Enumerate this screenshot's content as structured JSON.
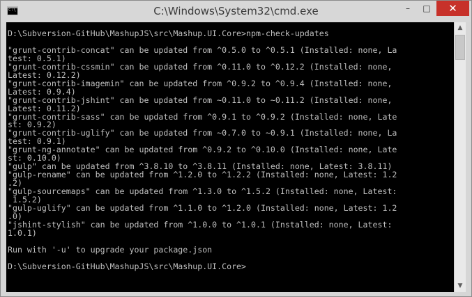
{
  "window": {
    "title": "C:\\Windows\\System32\\cmd.exe",
    "controls": {
      "minimize": "–",
      "maximize": "□",
      "close": "✕"
    },
    "icon": "cmd-icon",
    "icon_text": "C:\\"
  },
  "console": {
    "lines": [
      "D:\\Subversion-GitHub\\MashupJS\\src\\Mashup.UI.Core>npm-check-updates",
      "",
      "\"grunt-contrib-concat\" can be updated from ^0.5.0 to ^0.5.1 (Installed: none, La",
      "test: 0.5.1)",
      "\"grunt-contrib-cssmin\" can be updated from ^0.11.0 to ^0.12.2 (Installed: none,",
      "Latest: 0.12.2)",
      "\"grunt-contrib-imagemin\" can be updated from ^0.9.2 to ^0.9.4 (Installed: none,",
      "Latest: 0.9.4)",
      "\"grunt-contrib-jshint\" can be updated from ~0.11.0 to ~0.11.2 (Installed: none,",
      "Latest: 0.11.2)",
      "\"grunt-contrib-sass\" can be updated from ^0.9.1 to ^0.9.2 (Installed: none, Late",
      "st: 0.9.2)",
      "\"grunt-contrib-uglify\" can be updated from ~0.7.0 to ~0.9.1 (Installed: none, La",
      "test: 0.9.1)",
      "\"grunt-ng-annotate\" can be updated from ^0.9.2 to ^0.10.0 (Installed: none, Late",
      "st: 0.10.0)",
      "\"gulp\" can be updated from ^3.8.10 to ^3.8.11 (Installed: none, Latest: 3.8.11)",
      "\"gulp-rename\" can be updated from ^1.2.0 to ^1.2.2 (Installed: none, Latest: 1.2",
      ".2)",
      "\"gulp-sourcemaps\" can be updated from ^1.3.0 to ^1.5.2 (Installed: none, Latest:",
      " 1.5.2)",
      "\"gulp-uglify\" can be updated from ^1.1.0 to ^1.2.0 (Installed: none, Latest: 1.2",
      ".0)",
      "\"jshint-stylish\" can be updated from ^1.0.0 to ^1.0.1 (Installed: none, Latest:",
      "1.0.1)",
      "",
      "Run with '-u' to upgrade your package.json",
      "",
      "D:\\Subversion-GitHub\\MashupJS\\src\\Mashup.UI.Core>"
    ]
  },
  "scrollbar": {
    "up": "▲",
    "down": "▼"
  }
}
